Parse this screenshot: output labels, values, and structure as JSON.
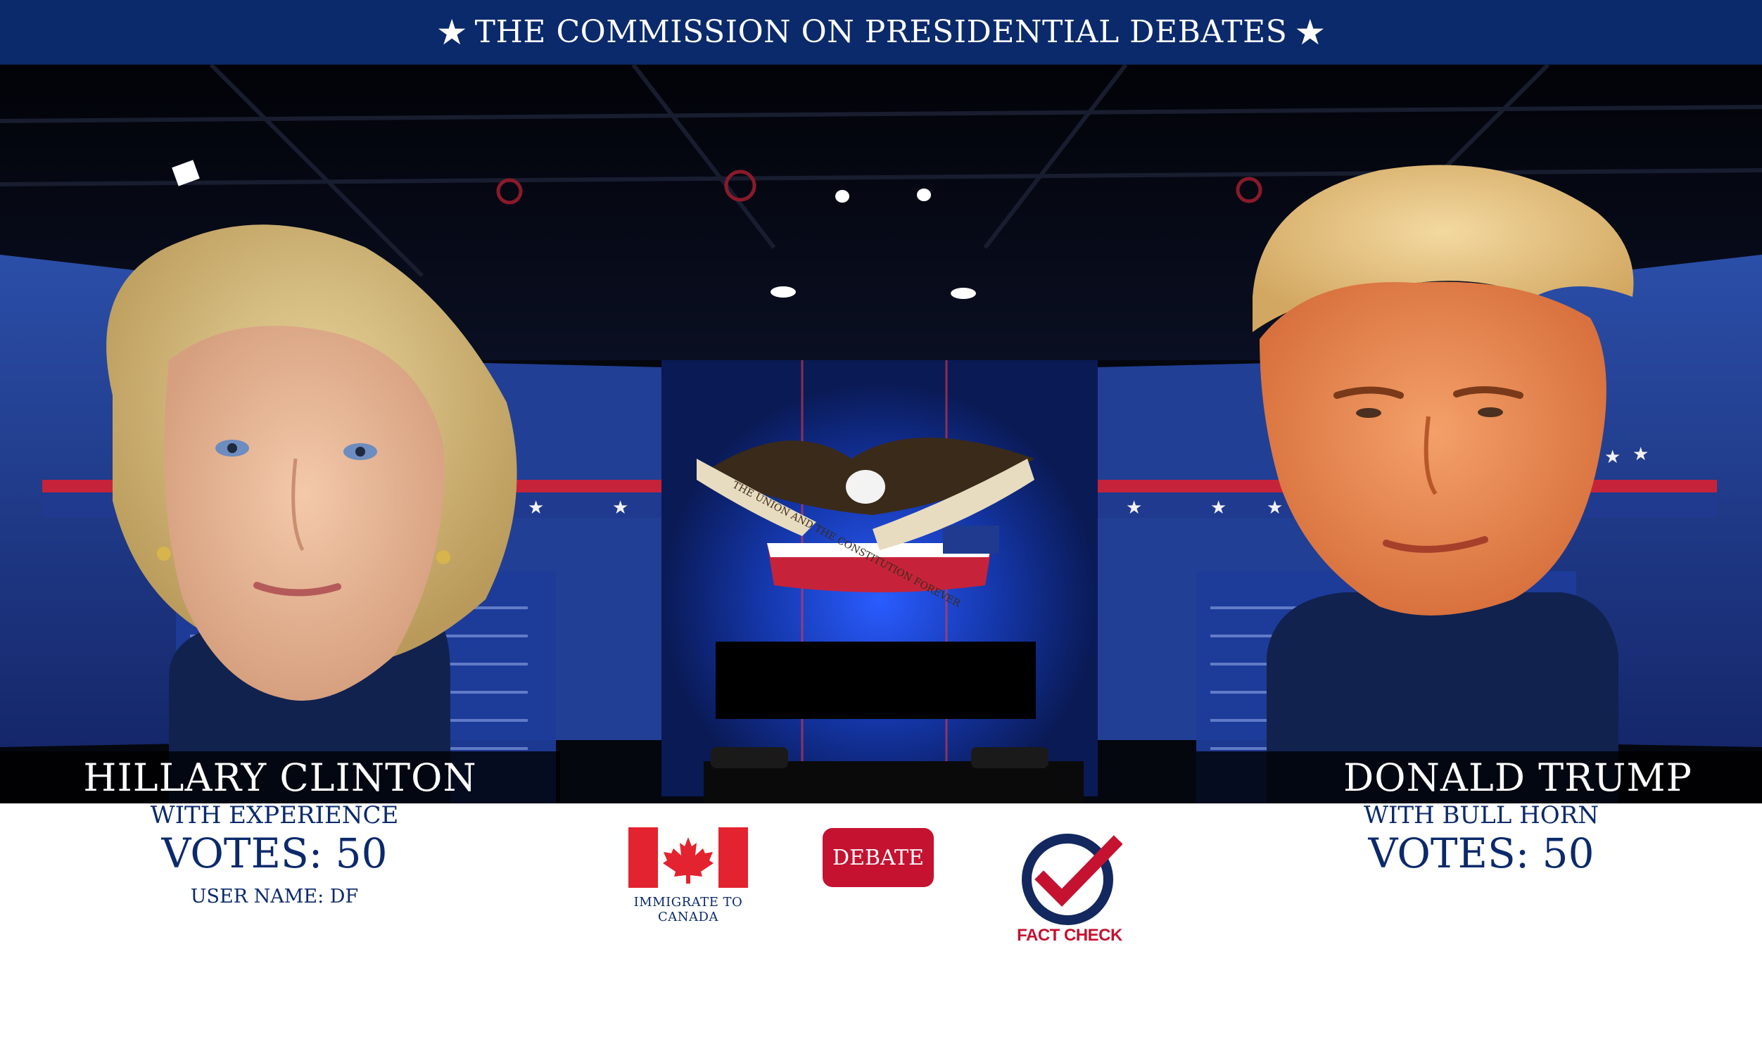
{
  "header": {
    "title": "THE COMMISSION ON PRESIDENTIAL DEBATES",
    "star_left": "★",
    "star_right": "★"
  },
  "stage": {
    "backdrop_banner_text": "THE UNION AND THE CONSTITUTION FOREVER"
  },
  "candidates": {
    "left": {
      "name": "HILLARY CLINTON",
      "subtitle": "WITH EXPERIENCE",
      "votes": "VOTES: 50",
      "user_name": "USER NAME: DF"
    },
    "right": {
      "name": "DONALD TRUMP",
      "subtitle": "WITH BULL HORN",
      "votes": "VOTES: 50"
    }
  },
  "actions": {
    "canada_caption": "IMMIGRATE TO CANADA",
    "debate_label": "DEBATE",
    "fact_check_caption": "FACT CHECK"
  },
  "colors": {
    "header_bg": "#0b2a6b",
    "accent_red": "#c41230",
    "text_navy": "#0b2a6b",
    "stage_blue": "#1b3f9e"
  },
  "icons": [
    "canada-flag-icon",
    "fact-check-icon",
    "star-icon",
    "eagle-emblem-icon"
  ]
}
